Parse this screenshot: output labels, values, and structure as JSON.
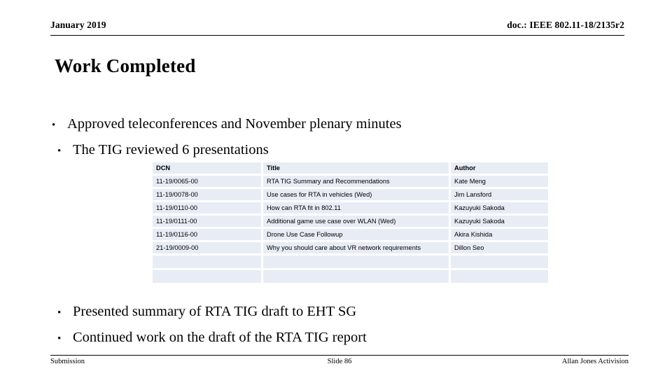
{
  "header": {
    "left": "January 2019",
    "right": "doc.: IEEE 802.11-18/2135r2"
  },
  "title": "Work Completed",
  "bullets_top": [
    {
      "marker": "•",
      "text": "Approved teleconferences and November plenary minutes"
    },
    {
      "marker": "•",
      "text": "The TIG reviewed 6 presentations"
    }
  ],
  "bullets_bottom": [
    {
      "marker": "•",
      "text": "Presented summary of RTA TIG draft to EHT SG"
    },
    {
      "marker": "•",
      "text": "Continued work on the draft of the RTA TIG report"
    }
  ],
  "table": {
    "columns": [
      "DCN",
      "Title",
      "Author"
    ],
    "rows": [
      {
        "dcn": "11-19/0065-00",
        "title": "RTA TIG Summary and Recommendations",
        "author": "Kate Meng"
      },
      {
        "dcn": "11-19/0078-00",
        "title": "Use cases for RTA in vehicles (Wed)",
        "author": "Jim Lansford"
      },
      {
        "dcn": "11-19/0110-00",
        "title": "How can RTA fit in 802.11",
        "author": "Kazuyuki Sakoda"
      },
      {
        "dcn": "11-19/0111-00",
        "title": "Additional game use case over WLAN (Wed)",
        "author": "Kazuyuki Sakoda"
      },
      {
        "dcn": "11-19/0116-00",
        "title": "Drone Use Case Followup",
        "author": "Akira Kishida"
      },
      {
        "dcn": "21-19/0009-00",
        "title": "Why you should care about VR network requirements",
        "author": "Dillon Seo"
      },
      {
        "dcn": "",
        "title": "",
        "author": ""
      },
      {
        "dcn": "",
        "title": "",
        "author": ""
      }
    ],
    "cell_fill": "#e8ecf5"
  },
  "footer": {
    "left": "Submission",
    "center": "Slide 86",
    "right": "Allan Jones Activision"
  }
}
